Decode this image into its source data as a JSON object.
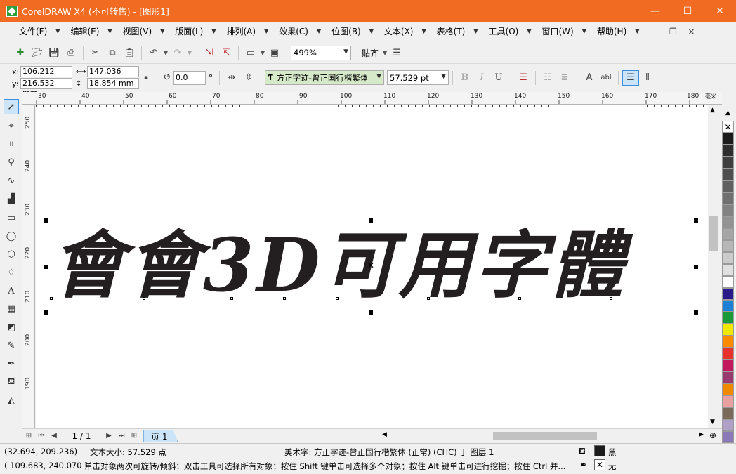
{
  "window": {
    "title": "CorelDRAW X4 (不可转售) - [图形1]",
    "minimize": "—",
    "maximize": "☐",
    "close": "✕"
  },
  "menu": {
    "items": [
      "文件(F)",
      "编辑(E)",
      "视图(V)",
      "版面(L)",
      "排列(A)",
      "效果(C)",
      "位图(B)",
      "文本(X)",
      "表格(T)",
      "工具(O)",
      "窗口(W)",
      "帮助(H)"
    ],
    "mdi_minimize": "–",
    "mdi_restore": "❐",
    "mdi_close": "×"
  },
  "standard_toolbar": {
    "zoom_level": "499%",
    "snap_label": "贴齐"
  },
  "property_bar": {
    "x_label": "x:",
    "x_value": "106.212 mm",
    "y_label": "y:",
    "y_value": "216.532 mm",
    "width_value": "147.036 mm",
    "height_value": "18.854 mm",
    "rotation_value": "0.0",
    "rotation_unit": "°",
    "font_name": "方正字迹-曾正国行楷繁体",
    "font_size": "57.529 pt",
    "bold": "B",
    "italic": "I",
    "underline": "U"
  },
  "rulers": {
    "h_labels": [
      "30",
      "40",
      "50",
      "60",
      "70",
      "80",
      "90",
      "100",
      "110",
      "120",
      "130",
      "140",
      "150",
      "160",
      "170",
      "180"
    ],
    "h_unit": "毫米",
    "v_labels": [
      "250",
      "240",
      "230",
      "220",
      "210",
      "200",
      "190"
    ]
  },
  "canvas": {
    "artistic_text": "會會3D可用字體"
  },
  "page_nav": {
    "page_count": "1 / 1",
    "page_tab": "页 1"
  },
  "palette": {
    "colors": [
      "#1a1a1a",
      "#2e2e2e",
      "#3f3f3f",
      "#4f4f4f",
      "#606060",
      "#707070",
      "#828282",
      "#939393",
      "#a5a5a5",
      "#b7b7b7",
      "#cbcbcb",
      "#e0e0e0",
      "#ffffff",
      "#2a1a8a",
      "#1e7fd6",
      "#1b9a3a",
      "#f0e800",
      "#ff8a00",
      "#e8332a",
      "#c2185b",
      "#9a3b6f",
      "#f08a00",
      "#e8a0a0",
      "#7a6a5a",
      "#b0a0c8",
      "#8a7ab8"
    ]
  },
  "status": {
    "cursor_coords": "(32.694, 209.236)",
    "text_size": "文本大小: 57.529 点",
    "object_info": "美术字: 方正字迹-曾正国行楷繁体 (正常) (CHC) 于 图层 1",
    "fill_color_name": "黑",
    "outline_coords": "( 109.683, 240.070 )",
    "hint": "单击对象两次可旋转/倾斜；双击工具可选择所有对象；按住 Shift 键单击可选择多个对象；按住 Alt 键单击可进行挖掘；按住 Ctrl 并...",
    "outline_name": "无"
  }
}
